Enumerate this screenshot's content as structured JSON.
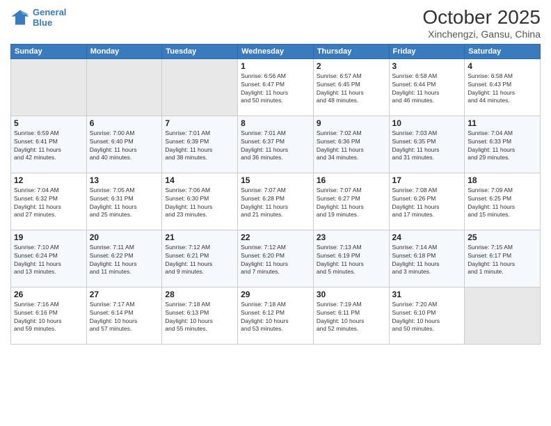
{
  "logo": {
    "line1": "General",
    "line2": "Blue"
  },
  "title": "October 2025",
  "subtitle": "Xinchengzi, Gansu, China",
  "weekdays": [
    "Sunday",
    "Monday",
    "Tuesday",
    "Wednesday",
    "Thursday",
    "Friday",
    "Saturday"
  ],
  "weeks": [
    [
      {
        "day": "",
        "info": ""
      },
      {
        "day": "",
        "info": ""
      },
      {
        "day": "",
        "info": ""
      },
      {
        "day": "1",
        "info": "Sunrise: 6:56 AM\nSunset: 6:47 PM\nDaylight: 11 hours\nand 50 minutes."
      },
      {
        "day": "2",
        "info": "Sunrise: 6:57 AM\nSunset: 6:45 PM\nDaylight: 11 hours\nand 48 minutes."
      },
      {
        "day": "3",
        "info": "Sunrise: 6:58 AM\nSunset: 6:44 PM\nDaylight: 11 hours\nand 46 minutes."
      },
      {
        "day": "4",
        "info": "Sunrise: 6:58 AM\nSunset: 6:43 PM\nDaylight: 11 hours\nand 44 minutes."
      }
    ],
    [
      {
        "day": "5",
        "info": "Sunrise: 6:59 AM\nSunset: 6:41 PM\nDaylight: 11 hours\nand 42 minutes."
      },
      {
        "day": "6",
        "info": "Sunrise: 7:00 AM\nSunset: 6:40 PM\nDaylight: 11 hours\nand 40 minutes."
      },
      {
        "day": "7",
        "info": "Sunrise: 7:01 AM\nSunset: 6:39 PM\nDaylight: 11 hours\nand 38 minutes."
      },
      {
        "day": "8",
        "info": "Sunrise: 7:01 AM\nSunset: 6:37 PM\nDaylight: 11 hours\nand 36 minutes."
      },
      {
        "day": "9",
        "info": "Sunrise: 7:02 AM\nSunset: 6:36 PM\nDaylight: 11 hours\nand 34 minutes."
      },
      {
        "day": "10",
        "info": "Sunrise: 7:03 AM\nSunset: 6:35 PM\nDaylight: 11 hours\nand 31 minutes."
      },
      {
        "day": "11",
        "info": "Sunrise: 7:04 AM\nSunset: 6:33 PM\nDaylight: 11 hours\nand 29 minutes."
      }
    ],
    [
      {
        "day": "12",
        "info": "Sunrise: 7:04 AM\nSunset: 6:32 PM\nDaylight: 11 hours\nand 27 minutes."
      },
      {
        "day": "13",
        "info": "Sunrise: 7:05 AM\nSunset: 6:31 PM\nDaylight: 11 hours\nand 25 minutes."
      },
      {
        "day": "14",
        "info": "Sunrise: 7:06 AM\nSunset: 6:30 PM\nDaylight: 11 hours\nand 23 minutes."
      },
      {
        "day": "15",
        "info": "Sunrise: 7:07 AM\nSunset: 6:28 PM\nDaylight: 11 hours\nand 21 minutes."
      },
      {
        "day": "16",
        "info": "Sunrise: 7:07 AM\nSunset: 6:27 PM\nDaylight: 11 hours\nand 19 minutes."
      },
      {
        "day": "17",
        "info": "Sunrise: 7:08 AM\nSunset: 6:26 PM\nDaylight: 11 hours\nand 17 minutes."
      },
      {
        "day": "18",
        "info": "Sunrise: 7:09 AM\nSunset: 6:25 PM\nDaylight: 11 hours\nand 15 minutes."
      }
    ],
    [
      {
        "day": "19",
        "info": "Sunrise: 7:10 AM\nSunset: 6:24 PM\nDaylight: 11 hours\nand 13 minutes."
      },
      {
        "day": "20",
        "info": "Sunrise: 7:11 AM\nSunset: 6:22 PM\nDaylight: 11 hours\nand 11 minutes."
      },
      {
        "day": "21",
        "info": "Sunrise: 7:12 AM\nSunset: 6:21 PM\nDaylight: 11 hours\nand 9 minutes."
      },
      {
        "day": "22",
        "info": "Sunrise: 7:12 AM\nSunset: 6:20 PM\nDaylight: 11 hours\nand 7 minutes."
      },
      {
        "day": "23",
        "info": "Sunrise: 7:13 AM\nSunset: 6:19 PM\nDaylight: 11 hours\nand 5 minutes."
      },
      {
        "day": "24",
        "info": "Sunrise: 7:14 AM\nSunset: 6:18 PM\nDaylight: 11 hours\nand 3 minutes."
      },
      {
        "day": "25",
        "info": "Sunrise: 7:15 AM\nSunset: 6:17 PM\nDaylight: 11 hours\nand 1 minute."
      }
    ],
    [
      {
        "day": "26",
        "info": "Sunrise: 7:16 AM\nSunset: 6:16 PM\nDaylight: 10 hours\nand 59 minutes."
      },
      {
        "day": "27",
        "info": "Sunrise: 7:17 AM\nSunset: 6:14 PM\nDaylight: 10 hours\nand 57 minutes."
      },
      {
        "day": "28",
        "info": "Sunrise: 7:18 AM\nSunset: 6:13 PM\nDaylight: 10 hours\nand 55 minutes."
      },
      {
        "day": "29",
        "info": "Sunrise: 7:18 AM\nSunset: 6:12 PM\nDaylight: 10 hours\nand 53 minutes."
      },
      {
        "day": "30",
        "info": "Sunrise: 7:19 AM\nSunset: 6:11 PM\nDaylight: 10 hours\nand 52 minutes."
      },
      {
        "day": "31",
        "info": "Sunrise: 7:20 AM\nSunset: 6:10 PM\nDaylight: 10 hours\nand 50 minutes."
      },
      {
        "day": "",
        "info": ""
      }
    ]
  ]
}
